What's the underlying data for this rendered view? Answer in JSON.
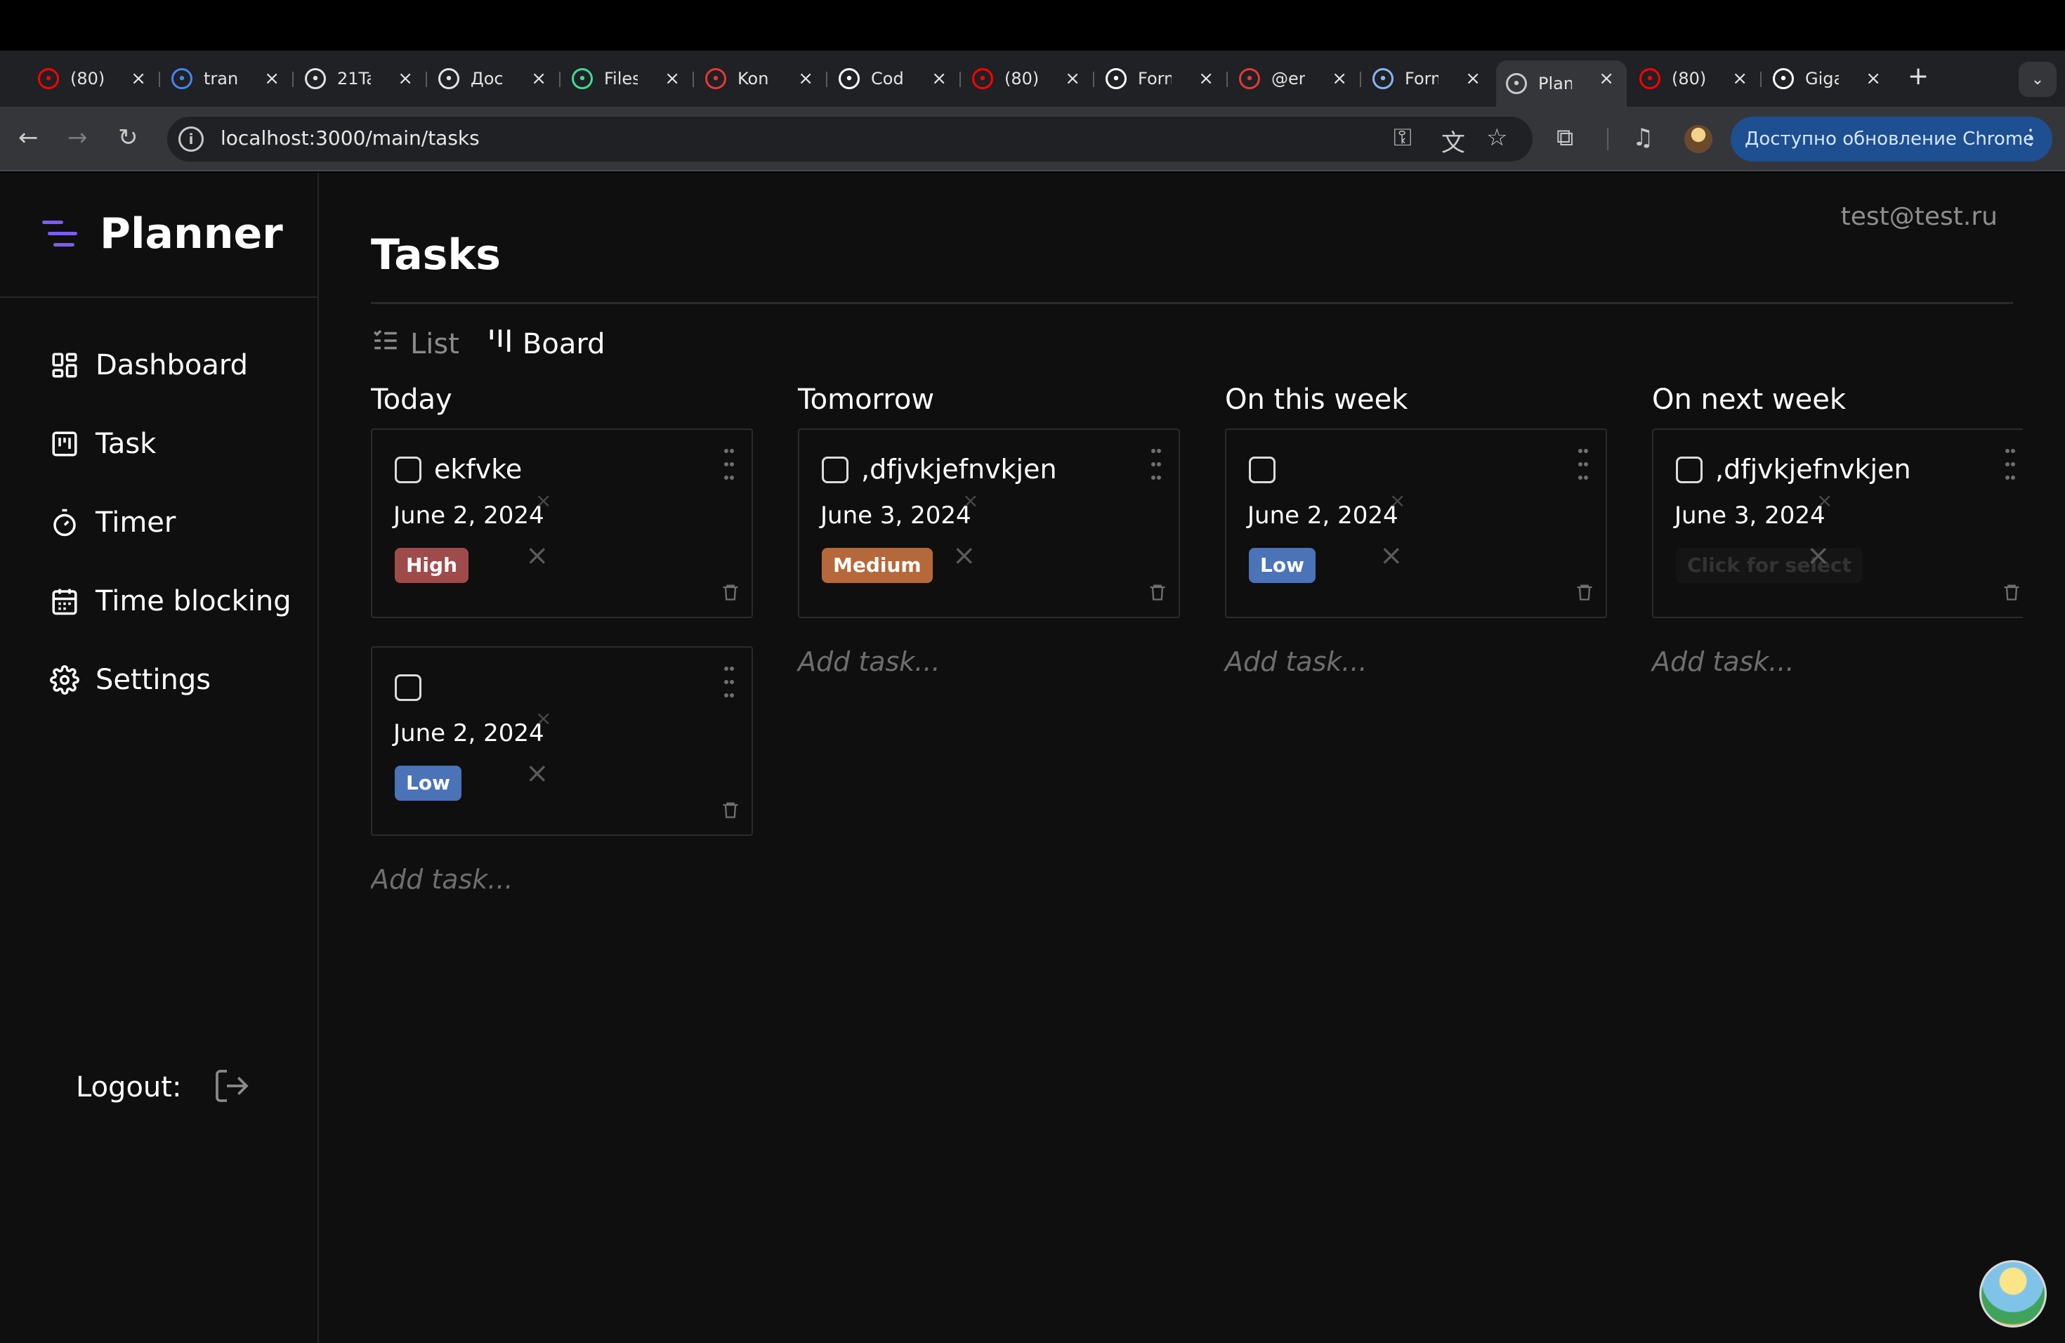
{
  "browser": {
    "tabs": [
      {
        "title": "(80)",
        "icon": "youtube-icon",
        "color": "#ff0000"
      },
      {
        "title": "translate",
        "icon": "google-icon",
        "color": "#4285f4"
      },
      {
        "title": "21Ta",
        "icon": "openai-icon",
        "color": "#e3e3e3"
      },
      {
        "title": "Доc",
        "icon": "globe-icon",
        "color": "#e3e3e3"
      },
      {
        "title": "Files",
        "icon": "files-icon",
        "color": "#3ddc97"
      },
      {
        "title": "Kon",
        "icon": "tower-icon",
        "color": "#e53935"
      },
      {
        "title": "Code",
        "icon": "github-icon",
        "color": "#ffffff"
      },
      {
        "title": "(80)",
        "icon": "youtube-icon",
        "color": "#ff0000"
      },
      {
        "title": "Form",
        "icon": "github-icon",
        "color": "#ffffff"
      },
      {
        "title": "@en",
        "icon": "brand-icon",
        "color": "#e53935"
      },
      {
        "title": "Form",
        "icon": "feather-icon",
        "color": "#8ab4f8"
      },
      {
        "title": "Plan",
        "icon": "globe-icon",
        "color": "#c8c8c8"
      },
      {
        "title": "(80)",
        "icon": "youtube-icon",
        "color": "#ff0000"
      },
      {
        "title": "Giga",
        "icon": "gigachat-icon",
        "color": "#ffffff"
      }
    ],
    "active_tab_index": 11,
    "url": "localhost:3000/main/tasks",
    "update_label": "Доступно обновление Chrome"
  },
  "app": {
    "logo": "Planner",
    "accent_color": "#7c5cf6",
    "nav": [
      {
        "label": "Dashboard",
        "icon": "dashboard-icon"
      },
      {
        "label": "Task",
        "icon": "kanban-icon"
      },
      {
        "label": "Timer",
        "icon": "timer-icon"
      },
      {
        "label": "Time blocking",
        "icon": "calendar-icon"
      },
      {
        "label": "Settings",
        "icon": "gear-icon"
      }
    ],
    "logout_label": "Logout:",
    "user_email": "test@test.ru",
    "page_title": "Tasks",
    "view_switch": {
      "list_label": "List",
      "board_label": "Board",
      "active": "Board"
    },
    "columns": [
      {
        "title": "Today",
        "add_label": "Add task...",
        "cards": [
          {
            "name": "ekfvke",
            "date": "June 2, 2024",
            "priority": "High",
            "priority_color": "#a04b4b"
          },
          {
            "name": "",
            "date": "June 2, 2024",
            "priority": "Low",
            "priority_color": "#4a73b8"
          }
        ]
      },
      {
        "title": "Tomorrow",
        "add_label": "Add task...",
        "cards": [
          {
            "name": ",dfjvkjefnvkjen",
            "date": "June 3, 2024",
            "priority": "Medium",
            "priority_color": "#b5693a"
          }
        ]
      },
      {
        "title": "On this week",
        "add_label": "Add task...",
        "cards": [
          {
            "name": "",
            "date": "June 2, 2024",
            "priority": "Low",
            "priority_color": "#4a73b8"
          }
        ]
      },
      {
        "title": "On next week",
        "add_label": "Add task...",
        "cards": [
          {
            "name": ",dfjvkjefnvkjen",
            "date": "June 3, 2024",
            "priority": "Click for select",
            "priority_color": "#151515"
          }
        ]
      }
    ]
  }
}
